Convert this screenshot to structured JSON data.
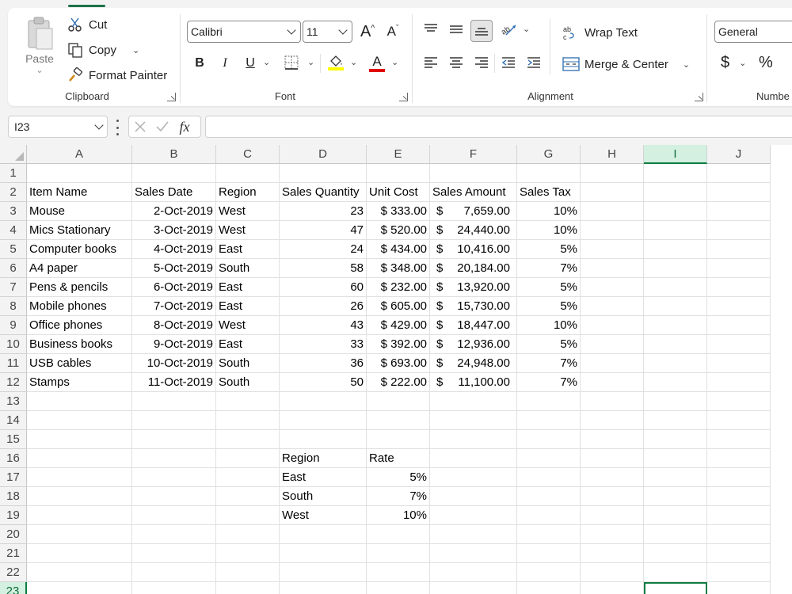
{
  "ribbon": {
    "clipboard": {
      "paste_label": "Paste",
      "cut_label": "Cut",
      "copy_label": "Copy",
      "format_painter_label": "Format Painter",
      "group_label": "Clipboard"
    },
    "font": {
      "font_name": "Calibri",
      "font_size": "11",
      "bold_label": "B",
      "italic_label": "I",
      "underline_label": "U",
      "grow_label": "A",
      "shrink_label": "A",
      "font_color_label": "A",
      "group_label": "Font",
      "highlight_color": "#ffff00",
      "font_color": "#e00000"
    },
    "alignment": {
      "wrap_text_label": "Wrap Text",
      "merge_center_label": "Merge & Center",
      "group_label": "Alignment"
    },
    "number": {
      "format_value": "General",
      "currency_label": "$",
      "percent_label": "%",
      "group_label": "Numbe"
    }
  },
  "formula_bar": {
    "name_box": "I23",
    "fx_label": "fx",
    "formula_value": ""
  },
  "grid": {
    "columns": [
      "A",
      "B",
      "C",
      "D",
      "E",
      "F",
      "G",
      "H",
      "I",
      "J"
    ],
    "selected_column": "I",
    "rows": [
      "1",
      "2",
      "3",
      "4",
      "5",
      "6",
      "7",
      "8",
      "9",
      "10",
      "11",
      "12",
      "13",
      "14",
      "15",
      "16",
      "17",
      "18",
      "19",
      "20",
      "21",
      "22",
      "23"
    ],
    "selected_row": "23",
    "headers": [
      "Item Name",
      "Sales Date",
      "Region",
      "Sales Quantity",
      "Unit Cost",
      "Sales Amount",
      "Sales Tax"
    ],
    "data": [
      {
        "item": "Mouse",
        "date": "2-Oct-2019",
        "region": "West",
        "qty": "23",
        "unit_cost": "$ 333.00",
        "amount_sym": "$",
        "amount": "7,659.00",
        "tax": "10%"
      },
      {
        "item": "Mics Stationary",
        "date": "3-Oct-2019",
        "region": "West",
        "qty": "47",
        "unit_cost": "$ 520.00",
        "amount_sym": "$",
        "amount": "24,440.00",
        "tax": "10%"
      },
      {
        "item": "Computer books",
        "date": "4-Oct-2019",
        "region": "East",
        "qty": "24",
        "unit_cost": "$ 434.00",
        "amount_sym": "$",
        "amount": "10,416.00",
        "tax": "5%"
      },
      {
        "item": "A4 paper",
        "date": "5-Oct-2019",
        "region": "South",
        "qty": "58",
        "unit_cost": "$ 348.00",
        "amount_sym": "$",
        "amount": "20,184.00",
        "tax": "7%"
      },
      {
        "item": "Pens & pencils",
        "date": "6-Oct-2019",
        "region": "East",
        "qty": "60",
        "unit_cost": "$ 232.00",
        "amount_sym": "$",
        "amount": "13,920.00",
        "tax": "5%"
      },
      {
        "item": "Mobile phones",
        "date": "7-Oct-2019",
        "region": "East",
        "qty": "26",
        "unit_cost": "$ 605.00",
        "amount_sym": "$",
        "amount": "15,730.00",
        "tax": "5%"
      },
      {
        "item": "Office phones",
        "date": "8-Oct-2019",
        "region": "West",
        "qty": "43",
        "unit_cost": "$ 429.00",
        "amount_sym": "$",
        "amount": "18,447.00",
        "tax": "10%"
      },
      {
        "item": "Business books",
        "date": "9-Oct-2019",
        "region": "East",
        "qty": "33",
        "unit_cost": "$ 392.00",
        "amount_sym": "$",
        "amount": "12,936.00",
        "tax": "5%"
      },
      {
        "item": "USB cables",
        "date": "10-Oct-2019",
        "region": "South",
        "qty": "36",
        "unit_cost": "$ 693.00",
        "amount_sym": "$",
        "amount": "24,948.00",
        "tax": "7%"
      },
      {
        "item": "Stamps",
        "date": "11-Oct-2019",
        "region": "South",
        "qty": "50",
        "unit_cost": "$ 222.00",
        "amount_sym": "$",
        "amount": "11,100.00",
        "tax": "7%"
      }
    ],
    "lookup": {
      "header_region": "Region",
      "header_rate": "Rate",
      "rows": [
        {
          "region": "East",
          "rate": "5%"
        },
        {
          "region": "South",
          "rate": "7%"
        },
        {
          "region": "West",
          "rate": "10%"
        }
      ]
    }
  },
  "accent_color": "#107c41"
}
